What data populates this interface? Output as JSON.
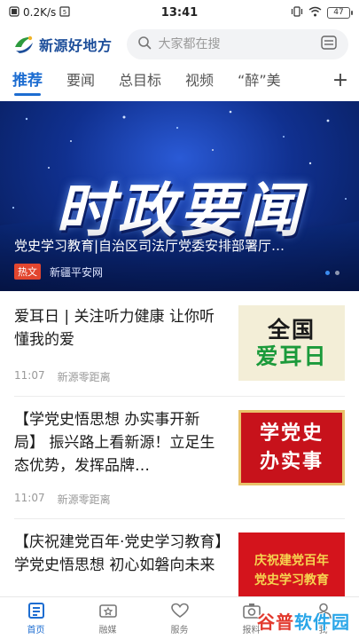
{
  "status_bar": {
    "speed": "0.2K/s",
    "time": "13:41",
    "battery": "47"
  },
  "header": {
    "app_name": "新源好地方",
    "search_placeholder": "大家都在搜"
  },
  "tabs": [
    {
      "label": "推荐",
      "active": true
    },
    {
      "label": "要闻",
      "active": false
    },
    {
      "label": "总目标",
      "active": false
    },
    {
      "label": "视频",
      "active": false
    },
    {
      "label": "“醉”美",
      "active": false
    }
  ],
  "tab_add_symbol": "+",
  "banner": {
    "image_text": "时政要闻",
    "title": "党史学习教育|自治区司法厅党委安排部署厅…",
    "badge": "热文",
    "source": "新疆平安网"
  },
  "news": [
    {
      "title": "爱耳日 | 关注听力健康 让你听懂我的爱",
      "time": "11:07",
      "source": "新源零距离",
      "thumb_lines": [
        "全国",
        "爱耳日"
      ]
    },
    {
      "title": "【学党史悟思想 办实事开新局】 振兴路上看新源！立足生态优势，发挥品牌…",
      "time": "11:07",
      "source": "新源零距离",
      "thumb_lines": [
        "学党史",
        "办实事"
      ]
    },
    {
      "title": "【庆祝建党百年·党史学习教育】学党史悟思想 初心如磐向未来",
      "time": "",
      "source": "",
      "thumb_lines": [
        "庆祝建党百年",
        "党史学习教育"
      ]
    }
  ],
  "bottom_nav": [
    {
      "label": "首页",
      "icon": "home-icon",
      "active": true
    },
    {
      "label": "融媒",
      "icon": "media-icon",
      "active": false
    },
    {
      "label": "服务",
      "icon": "heart-icon",
      "active": false
    },
    {
      "label": "报料",
      "icon": "camera-icon",
      "active": false
    },
    {
      "label": "我",
      "icon": "user-icon",
      "active": false
    }
  ],
  "watermark": {
    "part1": "谷普",
    "part2": "软件园"
  },
  "colors": {
    "accent": "#1d6dd1",
    "banner_bg": "#10308f",
    "hot_badge": "#e2462f"
  }
}
